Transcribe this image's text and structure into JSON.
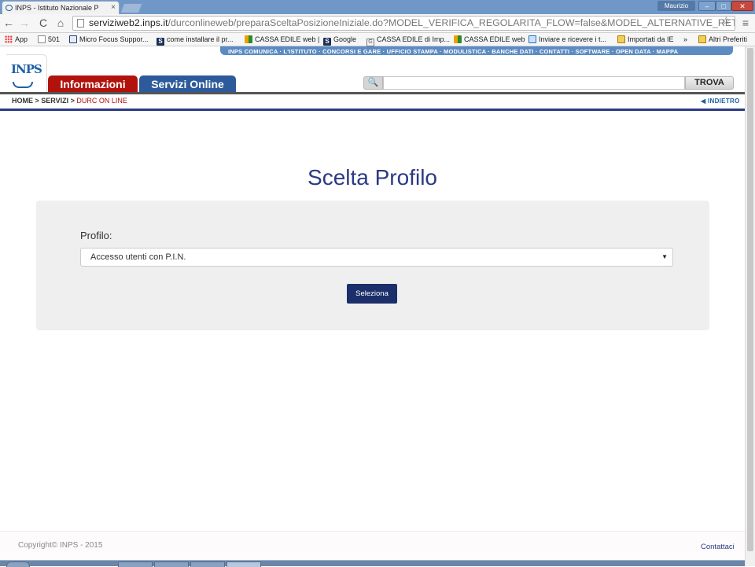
{
  "browser": {
    "tab_title": "INPS - Istituto Nazionale P",
    "tab_close": "×",
    "user": "Maurizio",
    "window_buttons": {
      "minimize": "–",
      "maximize": "□",
      "close": "✕"
    },
    "nav": {
      "back": "←",
      "forward": "→",
      "reload": "C",
      "home": "⌂"
    },
    "address": {
      "host": "serviziweb2.inps.it",
      "path": "/durconlineweb/preparaSceltaPosizioneIniziale.do?MODEL_VERIFICA_REGOLARITA_FLOW=false&MODEL_ALTERNATIVE_RETURN=&M"
    },
    "star": "☆",
    "menu": "≡",
    "bookmarks": [
      {
        "label": "App",
        "icon": "apps-icon"
      },
      {
        "label": "501",
        "icon": "page-icon"
      },
      {
        "label": "Micro Focus Suppor...",
        "icon": "microfocus-icon"
      },
      {
        "label": "come installare il pr...",
        "icon": "s-icon"
      },
      {
        "label": "CASSA EDILE web |",
        "icon": "cassa-edile-icon"
      },
      {
        "label": "Google",
        "icon": "s-icon"
      },
      {
        "label": "CASSA EDILE di Imp...",
        "icon": "google-g-icon"
      },
      {
        "label": "CASSA EDILE web",
        "icon": "cassa-edile-icon"
      },
      {
        "label": "Inviare e ricevere i t...",
        "icon": "mail-icon"
      },
      {
        "label": "Importati da IE",
        "icon": "folder-icon"
      },
      {
        "label": "»",
        "icon": ""
      },
      {
        "label": "Altri Preferiti",
        "icon": "folder-icon"
      }
    ]
  },
  "site": {
    "top_nav": "INPS COMUNICA · L'ISTITUTO · CONCORSI E GARE · UFFICIO STAMPA · MODULISTICA · BANCHE DATI · CONTATTI · SOFTWARE · OPEN DATA · MAPPA",
    "logo_text": "INPS",
    "tabs": [
      {
        "label": "Informazioni",
        "color": "#b2120c"
      },
      {
        "label": "Servizi Online",
        "color": "#2d5a9a"
      }
    ],
    "search": {
      "placeholder": "",
      "button_label": "TROVA",
      "icon": "search-icon"
    },
    "breadcrumb": {
      "home": "HOME",
      "sep": " > ",
      "section": "SERVIZI",
      "current": "DURC ON LINE"
    },
    "back_link": "INDIETRO"
  },
  "form": {
    "title": "Scelta Profilo",
    "field_label": "Profilo:",
    "selected_value": "Accesso utenti con P.I.N.",
    "submit_label": "Seleziona"
  },
  "footer": {
    "copyright": "Copyright© INPS - 2015",
    "contacts": "Contattaci"
  },
  "colors": {
    "title_blue": "#2b3a82",
    "red_tab": "#b2120c",
    "blue_tab": "#2d5a9a",
    "button_navy": "#1c2f6a",
    "panel_gray": "#efefef"
  }
}
